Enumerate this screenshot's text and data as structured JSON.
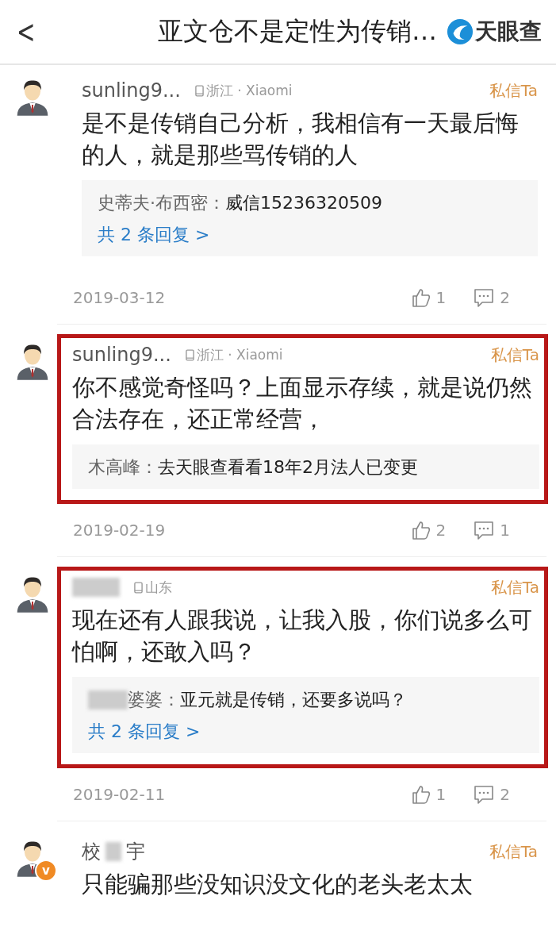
{
  "header": {
    "back": "<",
    "title": "亚文仓不是定性为传销…",
    "logo": "天眼查"
  },
  "comments": [
    {
      "name_parts": [
        "sunling9..."
      ],
      "name_blurred": false,
      "location": "浙江 · Xiaomi",
      "message": "私信Ta",
      "text": "是不是传销自己分析，我相信有一天最后悔的人，就是那些骂传销的人",
      "highlighted": false,
      "reply": {
        "author": "史蒂夫·布西密：",
        "author_blurred": false,
        "text": "威信15236320509"
      },
      "more": "共 2 条回复 >",
      "date": "2019-03-12",
      "likes": "1",
      "replies": "2"
    },
    {
      "name_parts": [
        "sunling9..."
      ],
      "name_blurred": false,
      "location": "浙江 · Xiaomi",
      "message": "私信Ta",
      "text": "你不感觉奇怪吗？上面显示存续，就是说仍然合法存在，还正常经营，",
      "highlighted": true,
      "reply": {
        "author": "木高峰：",
        "author_blurred": false,
        "text": "去天眼查看看18年2月法人已变更"
      },
      "date": "2019-02-19",
      "likes": "2",
      "replies": "1"
    },
    {
      "name_blurred": true,
      "location": "山东",
      "message": "私信Ta",
      "text": "现在还有人跟我说，让我入股，你们说多么可怕啊，还敢入吗？",
      "highlighted": true,
      "reply": {
        "author": "婆婆：",
        "author_blurred": true,
        "text": "亚元就是传销，还要多说吗？"
      },
      "more": "共 2 条回复 >",
      "date": "2019-02-11",
      "likes": "1",
      "replies": "2"
    },
    {
      "name_parts": [
        "校",
        "宇"
      ],
      "name_blurred": true,
      "badge": "v",
      "message": "私信Ta",
      "text": "只能骗那些没知识没文化的老头老太太",
      "highlighted": false
    }
  ]
}
